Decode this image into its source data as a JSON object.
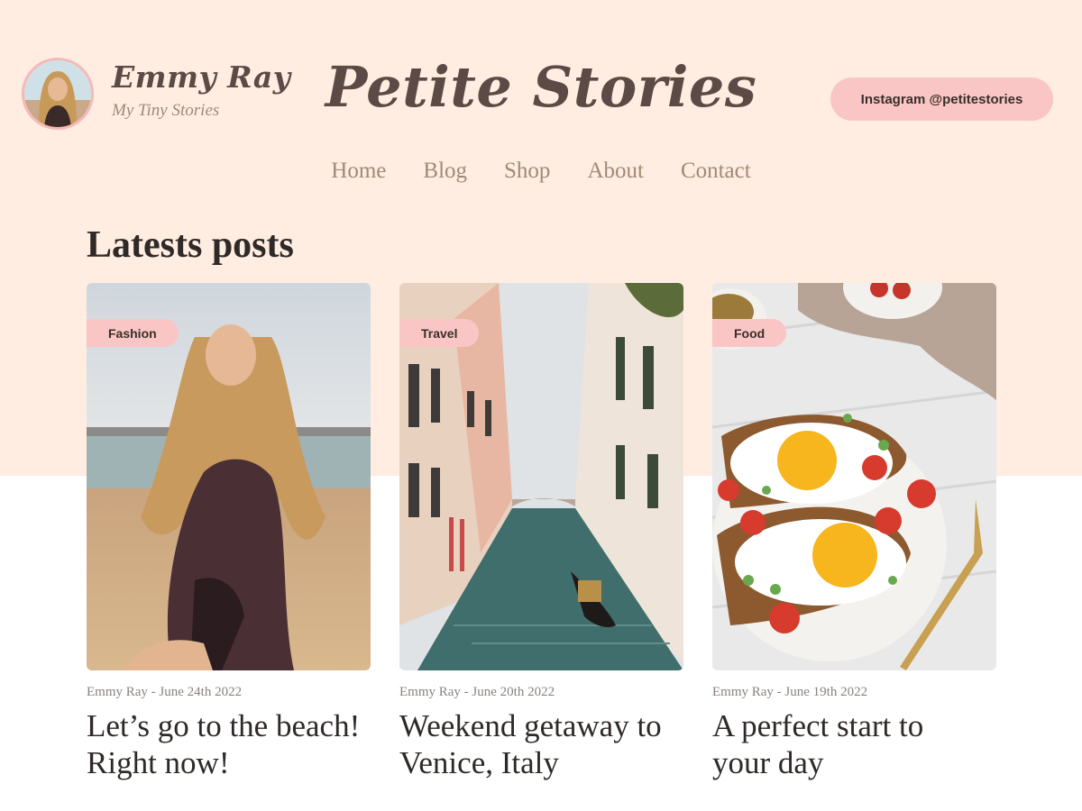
{
  "brand": {
    "name": "Emmy Ray",
    "tagline": "My Tiny Stories"
  },
  "site_title": "Petite Stories",
  "instagram_button": "Instagram @petitestories",
  "nav": [
    "Home",
    "Blog",
    "Shop",
    "About",
    "Contact"
  ],
  "section_title": "Latests posts",
  "posts": [
    {
      "category": "Fashion",
      "meta": "Emmy Ray - June 24th 2022",
      "title_line1": "Let’s go to the beach!",
      "title_line2": "Right now!",
      "image_icon": "beach-photo"
    },
    {
      "category": "Travel",
      "meta": "Emmy Ray - June 20th 2022",
      "title_line1": "Weekend getaway to",
      "title_line2": "Venice, Italy",
      "image_icon": "venice-canal-photo"
    },
    {
      "category": "Food",
      "meta": "Emmy Ray - June 19th 2022",
      "title_line1": "A perfect start to",
      "title_line2": "your day",
      "image_icon": "eggs-toast-photo"
    }
  ],
  "colors": {
    "hero_bg": "#ffede1",
    "accent_pink": "#f9c6c5",
    "brand_brown": "#5b4a45",
    "nav_text": "#a08a76"
  }
}
